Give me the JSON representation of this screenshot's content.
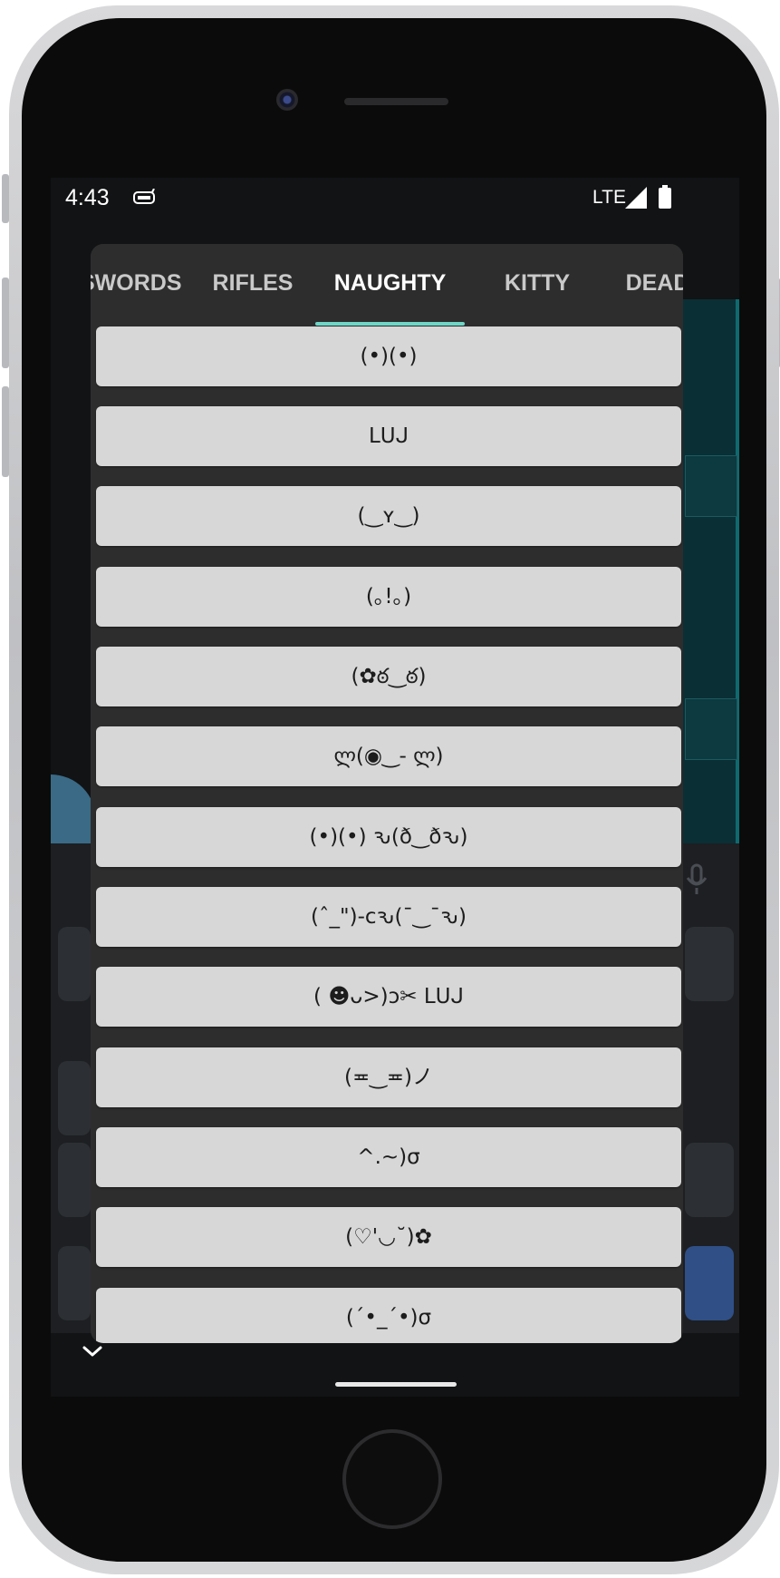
{
  "status_bar": {
    "time": "4:43",
    "network": "LTE",
    "app_icon": "robot-icon",
    "signal_icon": "signal-icon",
    "battery_icon": "battery-icon"
  },
  "popup": {
    "tabs": [
      {
        "label": "SWORDS",
        "active": false
      },
      {
        "label": "RIFLES",
        "active": false
      },
      {
        "label": "NAUGHTY",
        "active": true
      },
      {
        "label": "KITTY",
        "active": false
      },
      {
        "label": "DEAD",
        "active": false
      }
    ],
    "accent_color": "#6fd6c6",
    "items": [
      "(•)(•)",
      "ᒪᑌᒍ",
      "(‿ʏ‿)",
      "(｡!｡)",
      "(✿ఠ‿ఠ)",
      "ლ(◉‿- ლ)",
      "(•)(•) ԅ(ð‿ðԅ)",
      "(ˆ_\")-cԅ(¯‿¯ԅ)",
      "( ☻ᴗ>)ɔ✂ ᒪᑌᒍ",
      "(≖‿≖)ノ",
      "^.~)σ",
      "(♡'◡˘)✿",
      "(´•_´•)σ"
    ]
  },
  "navigation": {
    "collapse_icon": "chevron-down-icon",
    "home_indicator": "gesture-bar"
  }
}
